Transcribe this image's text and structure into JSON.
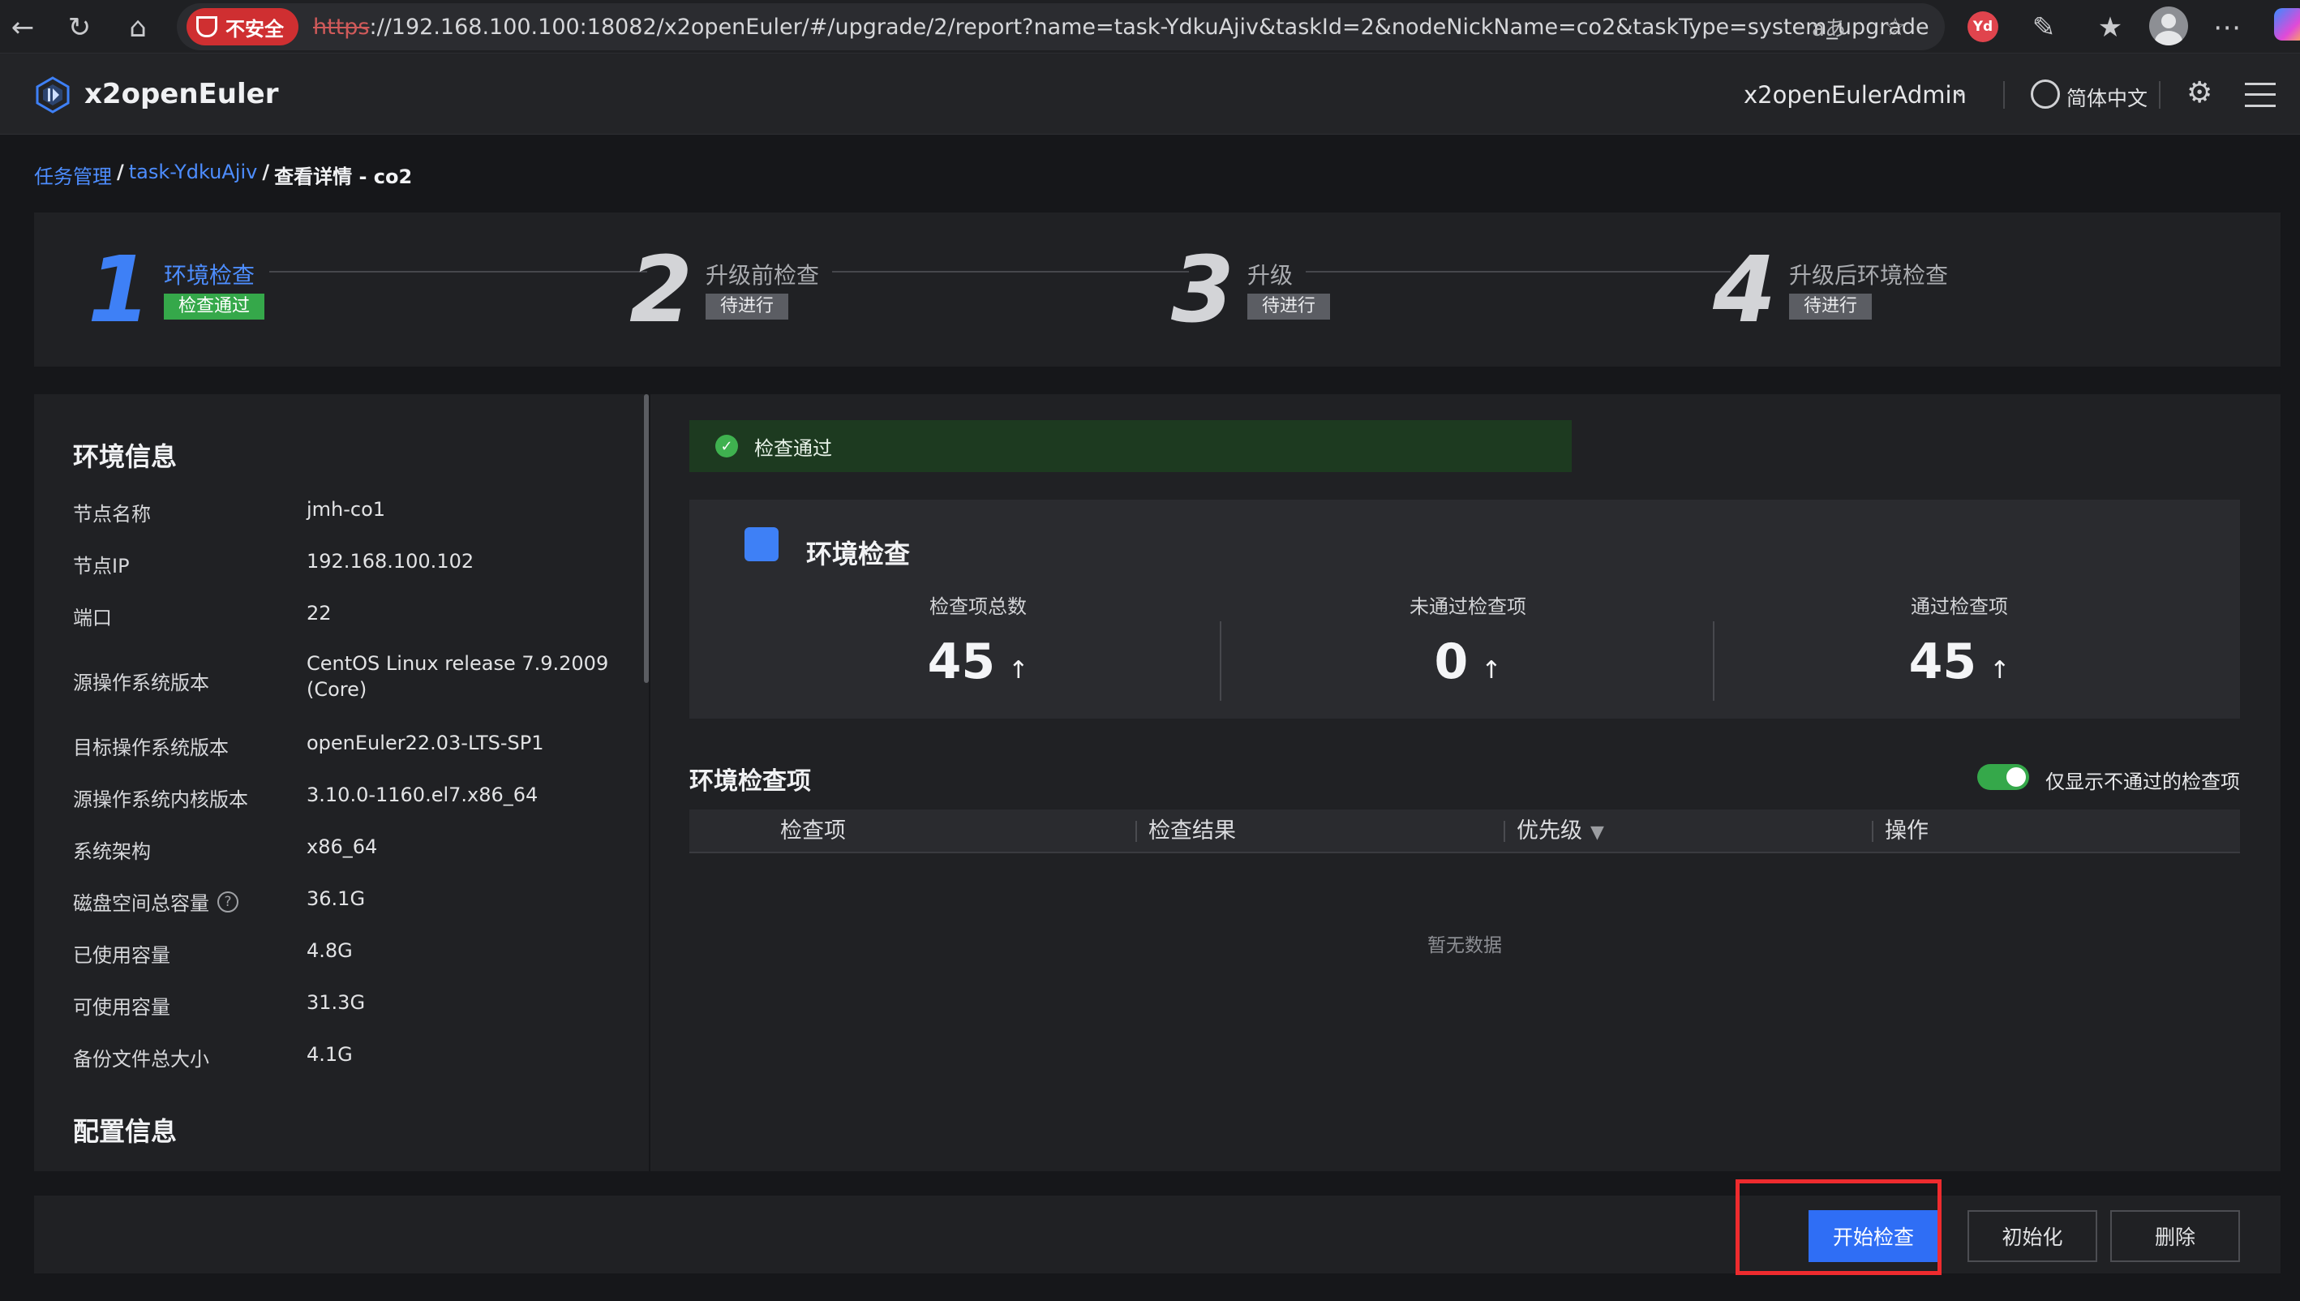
{
  "browser": {
    "insecure_label": "不安全",
    "url_scheme": "https",
    "url_rest": "://192.168.100.100:18082/x2openEuler/#/upgrade/2/report?name=task-YdkuAjiv&taskId=2&nodeNickName=co2&taskType=system_upgrade",
    "read_aloud_glyph": "aあ",
    "profile_badge": "Yd"
  },
  "header": {
    "app_name": "x2openEulerAdmin",
    "brand": "x2openEuler",
    "language": "简体中文"
  },
  "breadcrumb": {
    "root": "任务管理",
    "task": "task-YdkuAjiv",
    "sep": "/",
    "current": "查看详情 - co2"
  },
  "steps": [
    {
      "num": "1",
      "title": "环境检查",
      "status": "检查通过"
    },
    {
      "num": "2",
      "title": "升级前检查",
      "status": "待进行"
    },
    {
      "num": "3",
      "title": "升级",
      "status": "待进行"
    },
    {
      "num": "4",
      "title": "升级后环境检查",
      "status": "待进行"
    }
  ],
  "env_info": {
    "title": "环境信息",
    "rows": [
      {
        "label": "节点名称",
        "value": "jmh-co1"
      },
      {
        "label": "节点IP",
        "value": "192.168.100.102"
      },
      {
        "label": "端口",
        "value": "22"
      },
      {
        "label": "源操作系统版本",
        "value": "CentOS Linux release 7.9.2009 (Core)"
      },
      {
        "label": "目标操作系统版本",
        "value": "openEuler22.03-LTS-SP1"
      },
      {
        "label": "源操作系统内核版本",
        "value": "3.10.0-1160.el7.x86_64"
      },
      {
        "label": "系统架构",
        "value": "x86_64"
      },
      {
        "label": "磁盘空间总容量",
        "value": "36.1G"
      },
      {
        "label": "已使用容量",
        "value": "4.8G"
      },
      {
        "label": "可使用容量",
        "value": "31.3G"
      },
      {
        "label": "备份文件总大小",
        "value": "4.1G"
      }
    ],
    "config_title": "配置信息"
  },
  "check": {
    "banner": "检查通过",
    "title": "环境检查",
    "stats": [
      {
        "label": "检查项总数",
        "value": "45"
      },
      {
        "label": "未通过检查项",
        "value": "0"
      },
      {
        "label": "通过检查项",
        "value": "45"
      }
    ],
    "list_title": "环境检查项",
    "toggle_label": "仅显示不通过的检查项",
    "toggle_on": true,
    "columns": [
      "检查项",
      "检查结果",
      "优先级",
      "操作"
    ],
    "empty_text": "暂无数据"
  },
  "footer": {
    "start": "开始检查",
    "init": "初始化",
    "delete": "删除"
  },
  "colors": {
    "accent": "#3e80f6",
    "success": "#35a84a",
    "highlight": "#ee2b2e"
  }
}
